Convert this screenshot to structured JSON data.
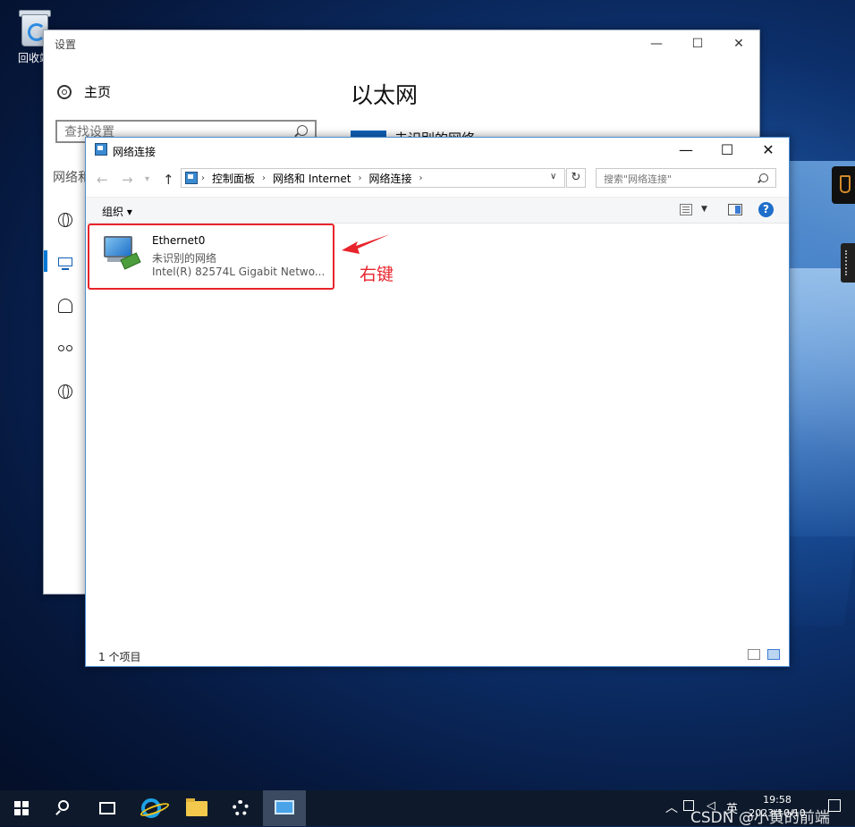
{
  "desktop": {
    "recycle_bin_label": "回收站"
  },
  "settings": {
    "title": "设置",
    "home_label": "主页",
    "search_placeholder": "查找设置",
    "section_label": "网络和 Internet",
    "page_heading": "以太网",
    "network_item_label": "未识别的网络",
    "controls": {
      "minimize": "—",
      "maximize": "☐",
      "close": "✕"
    }
  },
  "explorer": {
    "title": "网络连接",
    "controls": {
      "minimize": "—",
      "maximize": "☐",
      "close": "✕"
    },
    "address": {
      "breadcrumbs": [
        "控制面板",
        "网络和 Internet",
        "网络连接"
      ]
    },
    "search_placeholder": "搜索\"网络连接\"",
    "organize_label": "组织 ▾",
    "items": [
      {
        "name": "Ethernet0",
        "status": "未识别的网络",
        "description": "Intel(R) 82574L Gigabit Netwo..."
      }
    ],
    "annotation": "右键",
    "status_bar": "1 个项目",
    "help_label": "?"
  },
  "taskbar": {
    "tray_label": "英",
    "time": "19:58",
    "date": "2023/10/10",
    "watermark": "CSDN @小黄的前端"
  },
  "colors": {
    "accent": "#0078d7",
    "annotation": "#e8242b",
    "taskbar": "#0e1a2b"
  }
}
